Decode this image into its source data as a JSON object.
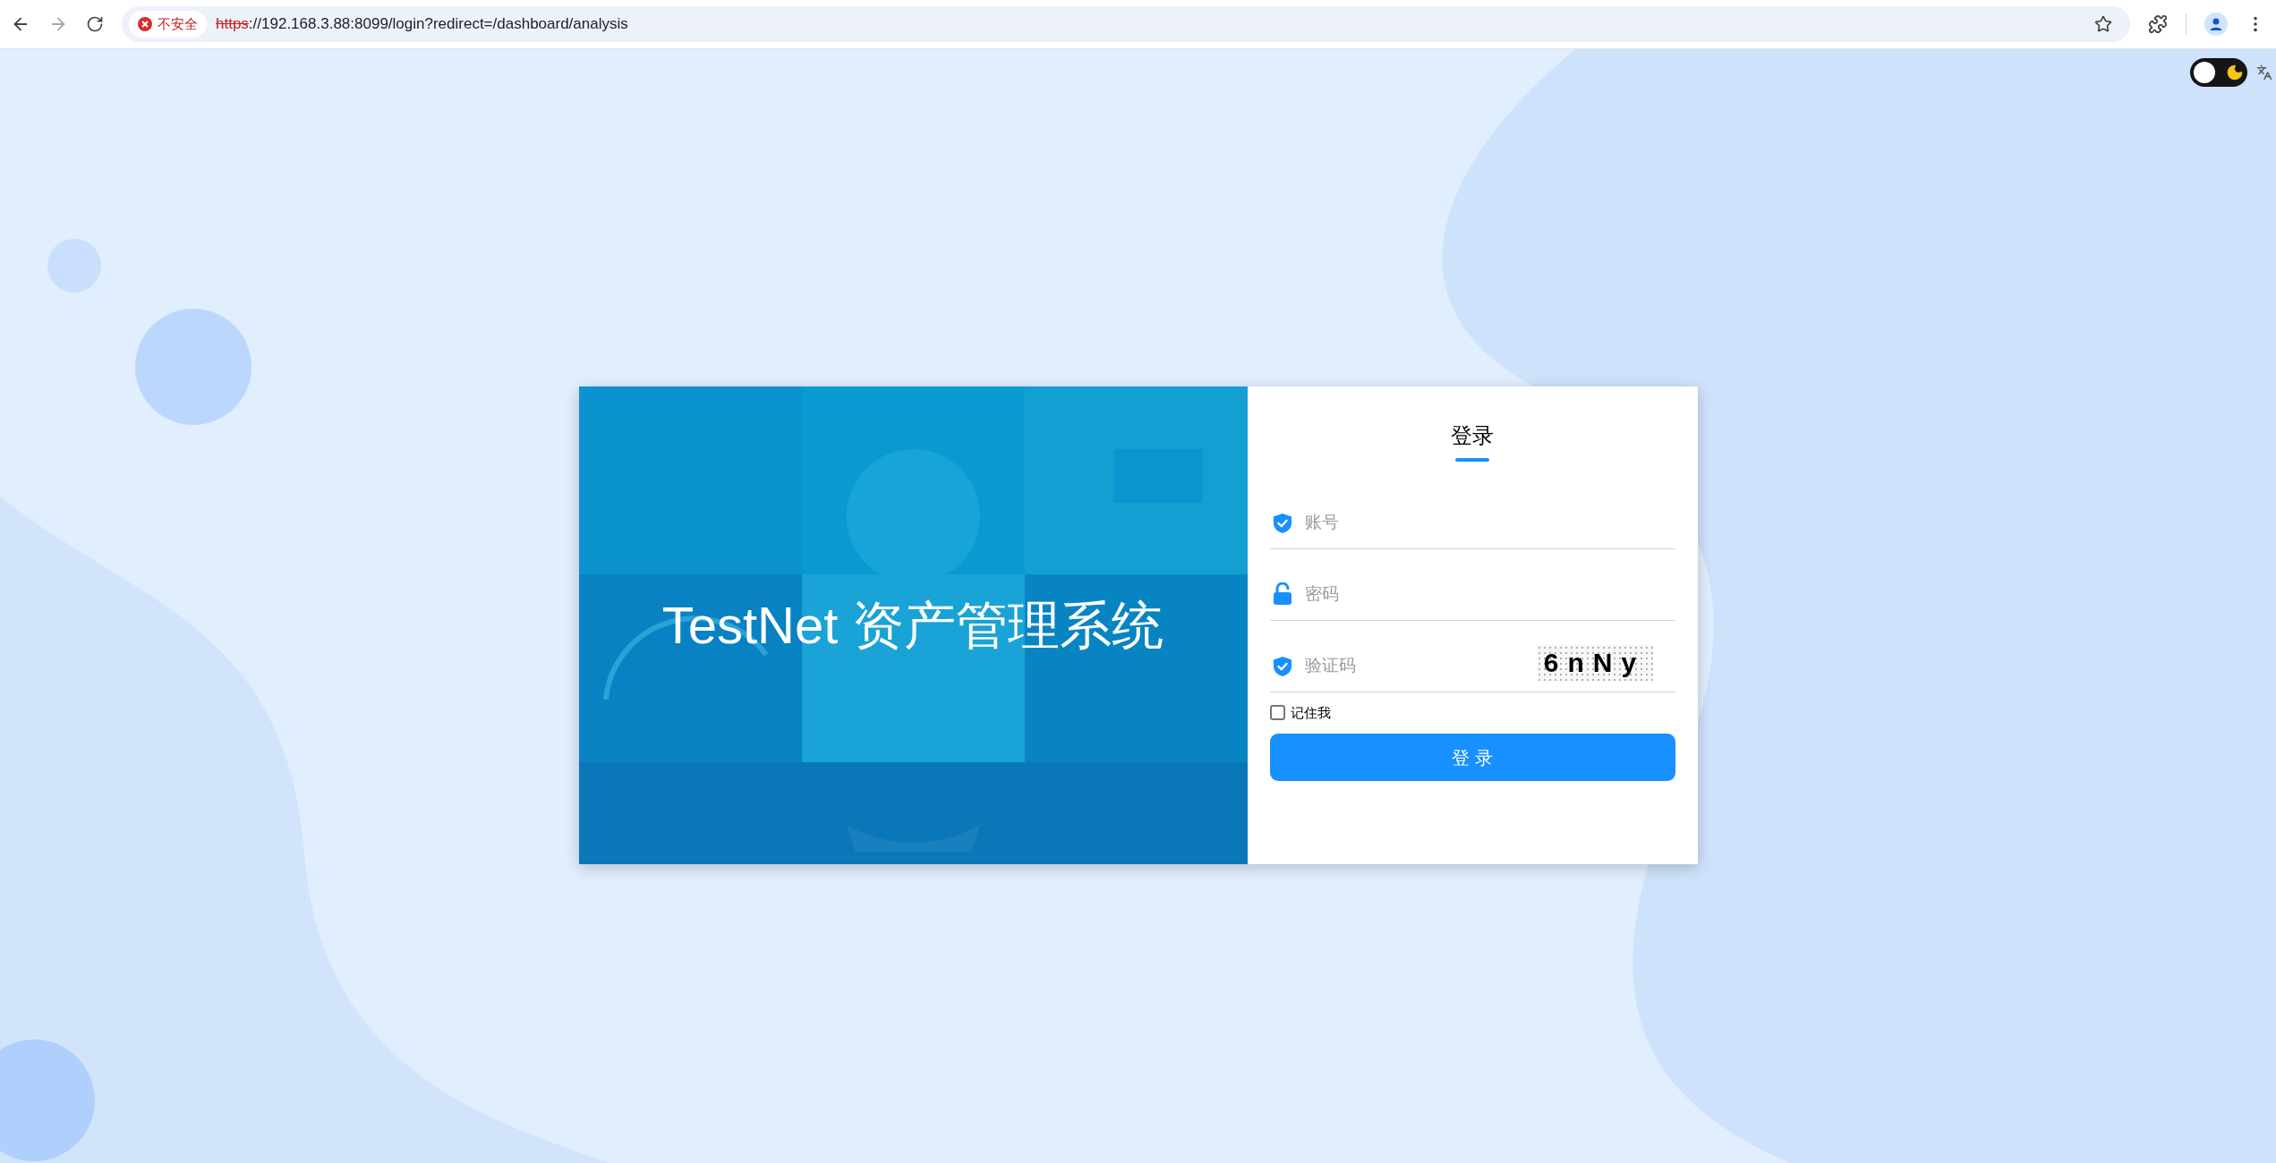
{
  "browser": {
    "forward_disabled": true,
    "security_label": "不安全",
    "url_scheme": "https",
    "url_rest": "://192.168.3.88:8099/login?redirect=/dashboard/analysis"
  },
  "theme_toggle": {
    "on": false
  },
  "banner": {
    "title": "TestNet 资产管理系统"
  },
  "login": {
    "title": "登录",
    "fields": [
      {
        "kind": "account",
        "placeholder": "账号"
      },
      {
        "kind": "password",
        "placeholder": "密码"
      },
      {
        "kind": "captcha",
        "placeholder": "验证码",
        "captcha": "6nNy"
      }
    ],
    "remember": {
      "label": "记住我",
      "checked": false
    },
    "submit": "登 录"
  }
}
